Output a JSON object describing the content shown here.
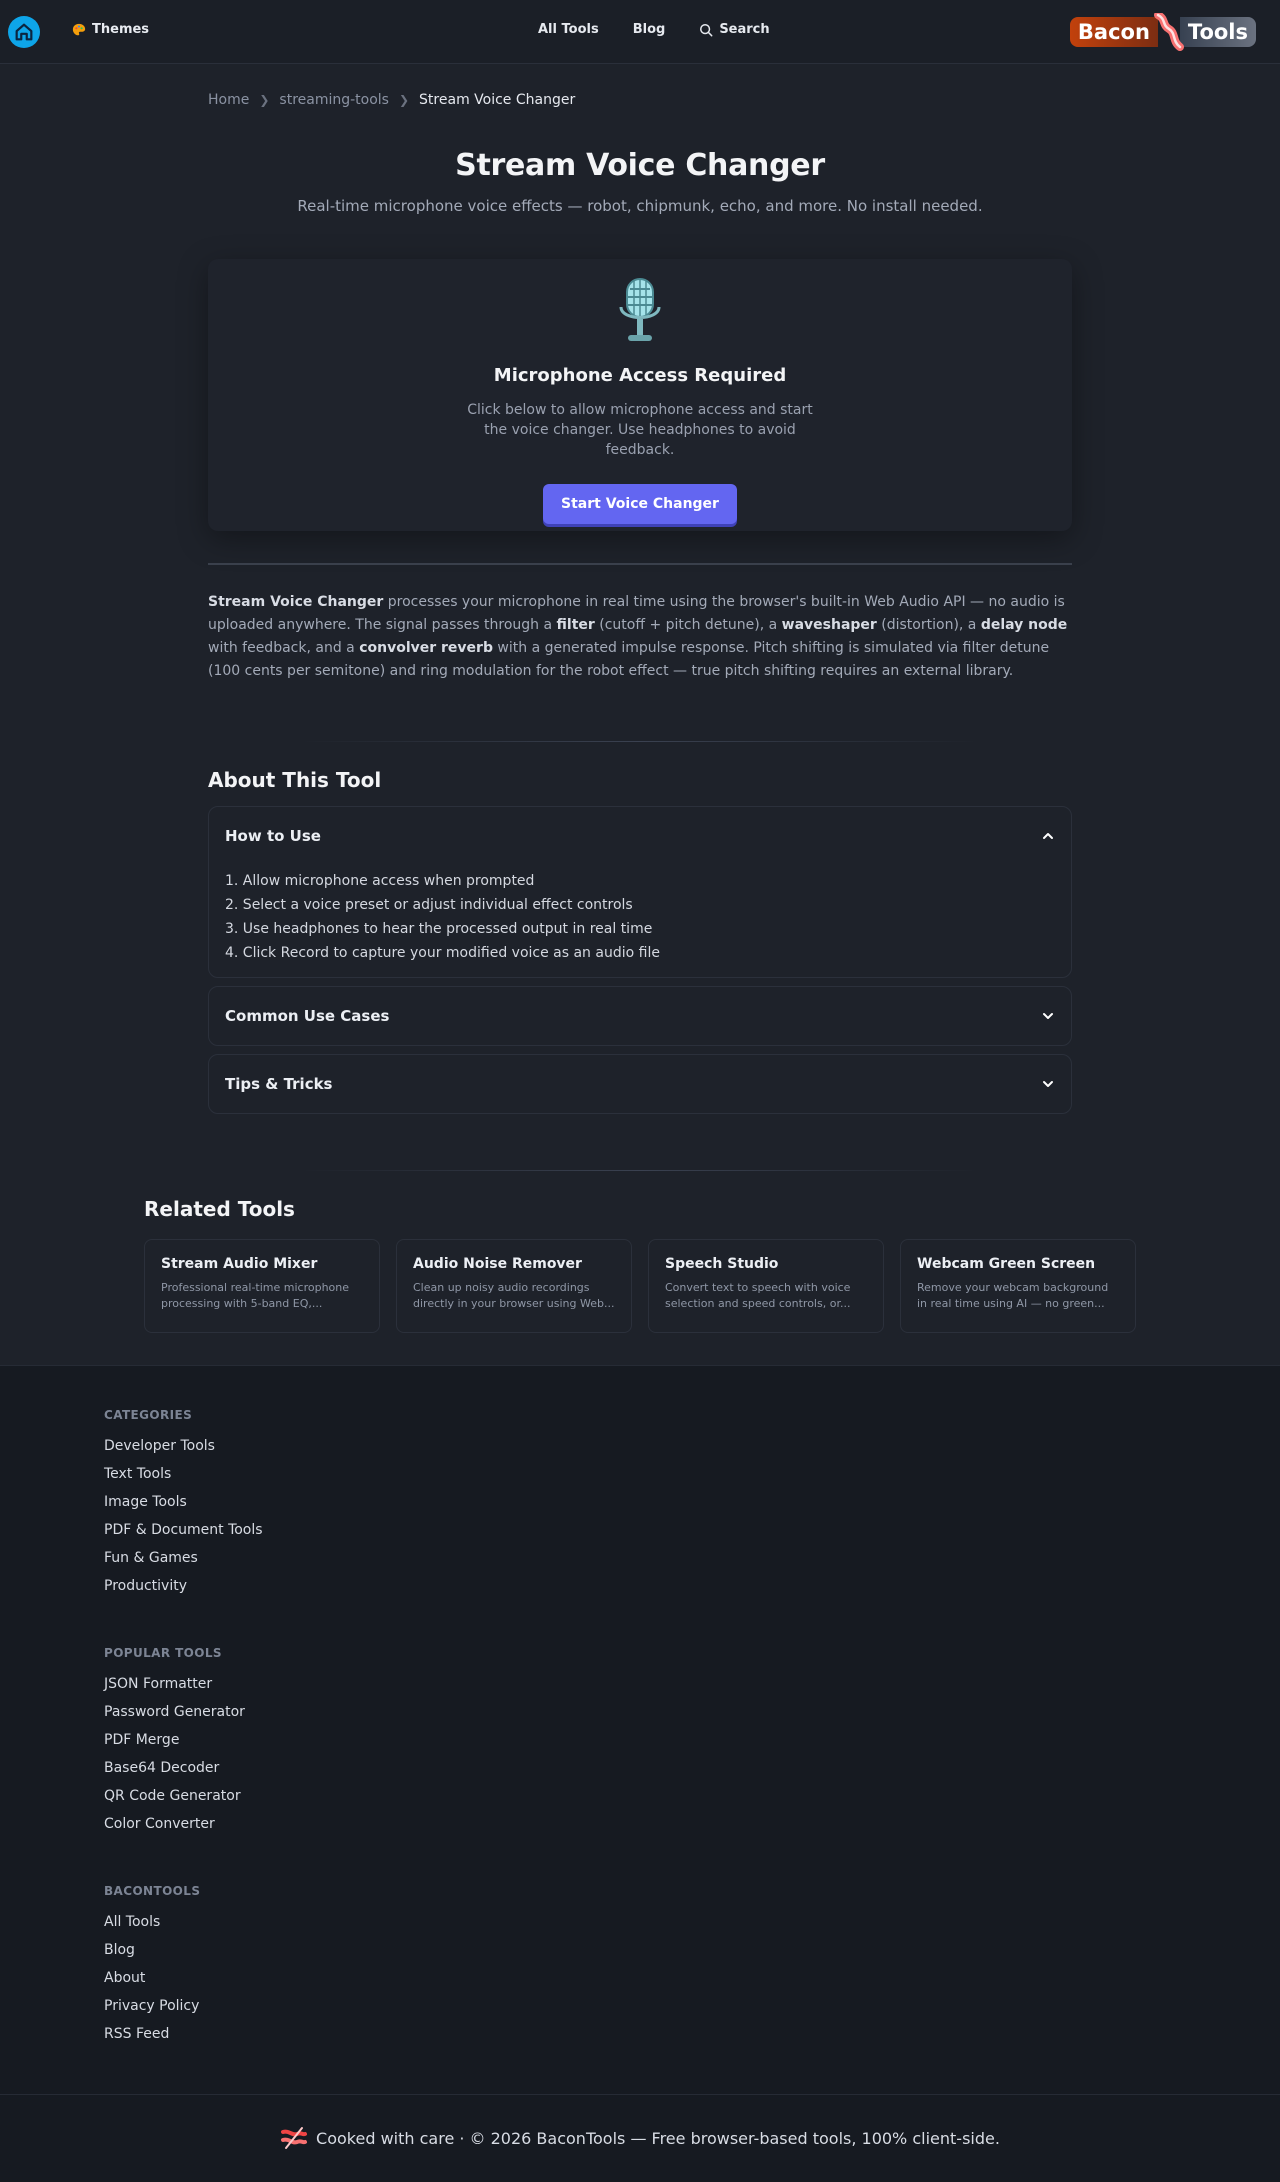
{
  "header": {
    "themes_label": "Themes",
    "nav": {
      "all_tools": "All Tools",
      "blog": "Blog",
      "search": "Search"
    },
    "logo": {
      "left": "Bacon",
      "right": "Tools"
    }
  },
  "breadcrumb": {
    "home": "Home",
    "category": "streaming-tools",
    "current": "Stream Voice Changer"
  },
  "page": {
    "title": "Stream Voice Changer",
    "subtitle": "Real-time microphone voice effects — robot, chipmunk, echo, and more. No install needed."
  },
  "mic_card": {
    "heading": "Microphone Access Required",
    "text": "Click below to allow microphone access and start the voice changer. Use headphones to avoid feedback.",
    "button": "Start Voice Changer"
  },
  "description": {
    "p1_strong": "Stream Voice Changer",
    "p1_a": " processes your microphone in real time using the browser's built-in Web Audio API — no audio is uploaded anywhere. The signal passes through a ",
    "filter": "filter",
    "p1_b": " (cutoff + pitch detune), a ",
    "waveshaper": "waveshaper",
    "p1_c": " (distortion), a ",
    "delay": "delay node",
    "p1_d": " with feedback, and a ",
    "reverb": "convolver reverb",
    "p1_e": " with a generated impulse response. Pitch shifting is simulated via filter detune (100 cents per semitone) and ring modulation for the robot effect — true pitch shifting requires an external library."
  },
  "about": {
    "heading": "About This Tool",
    "how_to": {
      "title": "How to Use",
      "steps": [
        "1. Allow microphone access when prompted",
        "2. Select a voice preset or adjust individual effect controls",
        "3. Use headphones to hear the processed output in real time",
        "4. Click Record to capture your modified voice as an audio file"
      ]
    },
    "use_cases": {
      "title": "Common Use Cases"
    },
    "tips": {
      "title": "Tips & Tricks"
    }
  },
  "related": {
    "heading": "Related Tools",
    "cards": [
      {
        "title": "Stream Audio Mixer",
        "desc": "Professional real-time microphone processing with 5-band EQ,..."
      },
      {
        "title": "Audio Noise Remover",
        "desc": "Clean up noisy audio recordings directly in your browser using Web..."
      },
      {
        "title": "Speech Studio",
        "desc": "Convert text to speech with voice selection and speed controls, or..."
      },
      {
        "title": "Webcam Green Screen",
        "desc": "Remove your webcam background in real time using AI — no green..."
      }
    ]
  },
  "footer": {
    "categories": {
      "heading": "CATEGORIES",
      "items": [
        "Developer Tools",
        "Text Tools",
        "Image Tools",
        "PDF & Document Tools",
        "Fun & Games",
        "Productivity"
      ]
    },
    "popular": {
      "heading": "POPULAR TOOLS",
      "items": [
        "JSON Formatter",
        "Password Generator",
        "PDF Merge",
        "Base64 Decoder",
        "QR Code Generator",
        "Color Converter"
      ]
    },
    "bacontools": {
      "heading": "BACONTOOLS",
      "items": [
        "All Tools",
        "Blog",
        "About",
        "Privacy Policy",
        "RSS Feed"
      ]
    },
    "copyright": "Cooked with care · © 2026 BaconTools — Free browser-based tools, 100% client-side."
  },
  "colors": {
    "accent": "#6366f1",
    "home_icon": "#0ea5e9",
    "background": "#1e222a",
    "footer_bg": "#161a21"
  },
  "icons": [
    "home-icon",
    "palette-icon",
    "search-icon",
    "microphone-icon",
    "chevron-up-icon",
    "chevron-down-icon",
    "bacon-icon"
  ]
}
